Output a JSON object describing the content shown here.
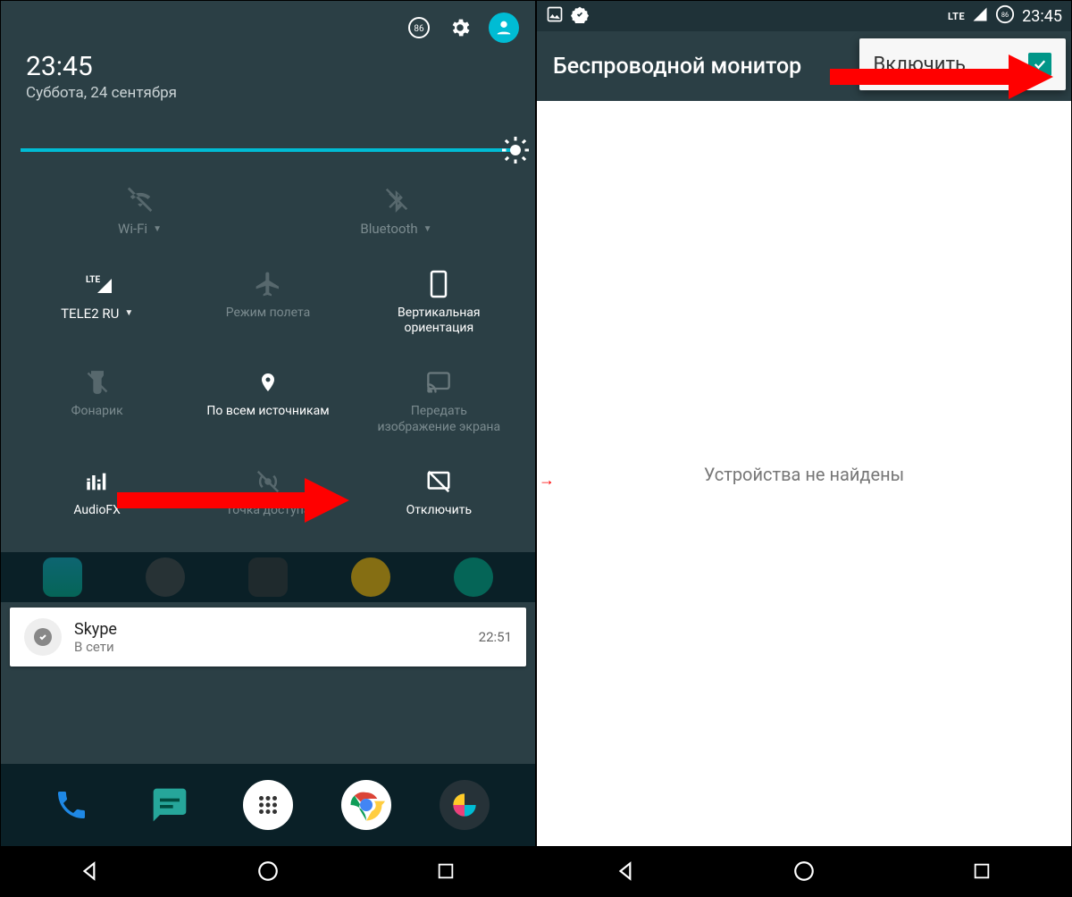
{
  "left": {
    "status_battery": "86",
    "clock": "23:45",
    "date": "Суббота, 24 сентября",
    "tiles": {
      "wifi": "Wi-Fi",
      "bluetooth": "Bluetooth",
      "cell": "TELE2 RU",
      "cell_net": "LTE",
      "airplane": "Режим полета",
      "orientation_l1": "Вертикальная",
      "orientation_l2": "ориентация",
      "flash": "Фонарик",
      "location": "По всем источникам",
      "cast_l1": "Передать",
      "cast_l2": "изображение экрана",
      "audiofx": "AudioFX",
      "hotspot": "Точка доступа",
      "disable": "Отключить"
    },
    "notification": {
      "title": "Skype",
      "sub": "В сети",
      "time": "22:51"
    }
  },
  "right": {
    "status": {
      "time": "23:45",
      "battery": "86",
      "net": "LTE"
    },
    "appbar_title": "Беспроводной монитор",
    "enable_label": "Включить",
    "empty": "Устройства не найдены"
  },
  "colors": {
    "accent": "#00bcd4",
    "teal": "#009688",
    "panel": "#2b3f45"
  }
}
